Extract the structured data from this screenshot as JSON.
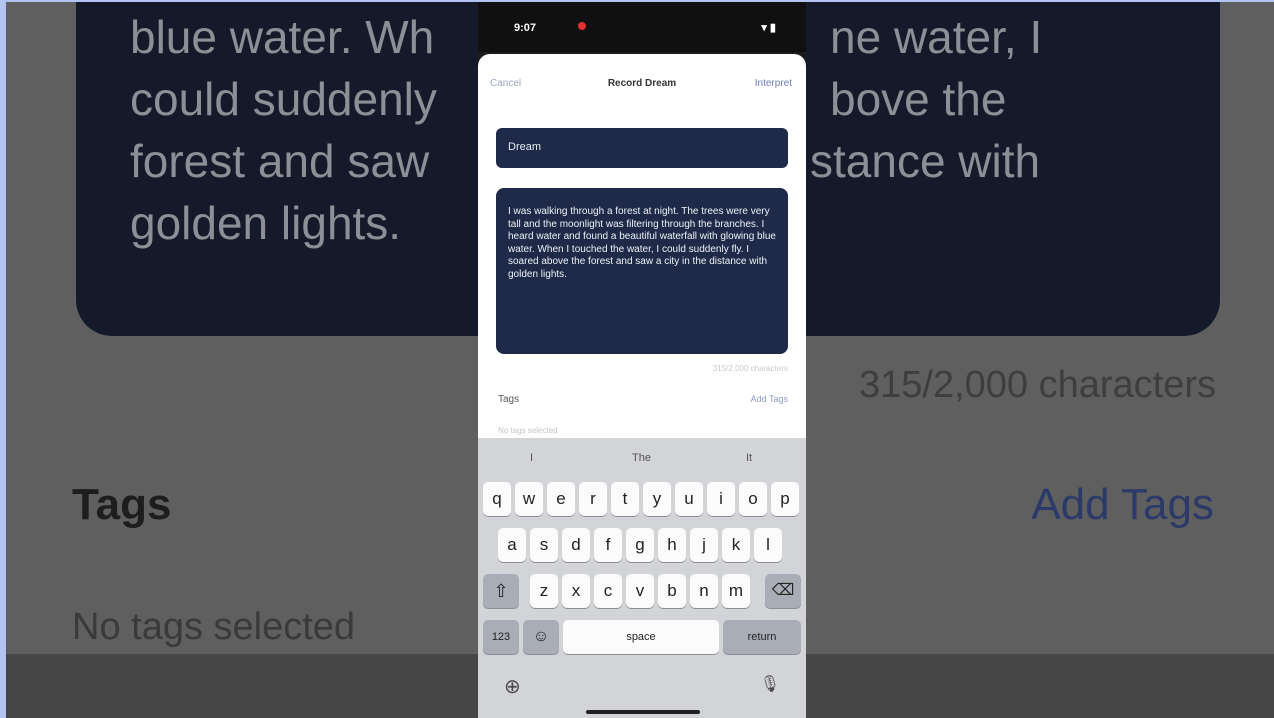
{
  "background": {
    "dream_text_lines": [
      "blue water. Wh",
      "could suddenly",
      "forest and saw",
      "golden lights."
    ],
    "dream_text_right_lines": [
      "ne water, I",
      "bove the",
      "stance with",
      ""
    ],
    "char_count": "315/2,000 characters",
    "tags_label": "Tags",
    "add_tags": "Add Tags",
    "no_tags": "No tags selected"
  },
  "status_bar": {
    "time": "9:07",
    "icons": "▾ ▮"
  },
  "nav": {
    "cancel": "Cancel",
    "title": "Record Dream",
    "save": "Interpret"
  },
  "title_field": {
    "value": "Dream"
  },
  "description": {
    "value": "I was walking through a forest at night. The trees were very tall and the moonlight was filtering through the branches. I heard water and found a beautiful waterfall with glowing blue water. When I touched the water, I could suddenly fly. I soared above the forest and saw a city in the distance with golden lights."
  },
  "char_counter": "315/2,000 characters",
  "tags": {
    "label": "Tags",
    "add": "Add Tags",
    "empty": "No tags selected"
  },
  "keyboard": {
    "suggestions": [
      "I",
      "The",
      "It"
    ],
    "row1": [
      "q",
      "w",
      "e",
      "r",
      "t",
      "y",
      "u",
      "i",
      "o",
      "p"
    ],
    "row2": [
      "a",
      "s",
      "d",
      "f",
      "g",
      "h",
      "j",
      "k",
      "l"
    ],
    "row3": [
      "z",
      "x",
      "c",
      "v",
      "b",
      "n",
      "m"
    ],
    "shift": "⇧",
    "delete": "⌫",
    "numbers": "123",
    "emoji": "☺",
    "space": "space",
    "return": "return",
    "globe": "⊕",
    "mic": "🎙"
  }
}
